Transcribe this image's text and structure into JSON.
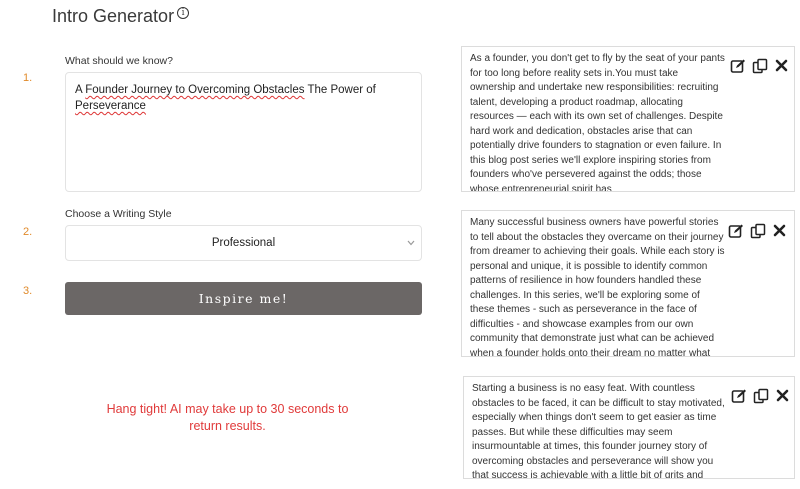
{
  "app": {
    "title": "Intro Generator",
    "info_glyph": "i"
  },
  "form": {
    "steps": [
      "1.",
      "2.",
      "3."
    ],
    "question_label": "What should we know?",
    "prompt_part1": "A ",
    "prompt_part2": "Founder Journey to Overcoming Obstacles",
    "prompt_part3": " The Power of ",
    "prompt_part4": "Perseverance",
    "style_label": "Choose a Writing Style",
    "style_value": "Professional",
    "submit_label": "Inspire me!",
    "wait_message": "Hang tight! AI may take up to 30 seconds to return results."
  },
  "results": [
    {
      "text": "As a founder, you don't get to fly by the seat of your pants for too long before reality sets in.You must take ownership and undertake new responsibilities: recruiting talent, developing a product roadmap, allocating resources — each with its own set of challenges. Despite hard work and dedication, obstacles arise that can potentially drive founders to stagnation or even failure. In this blog post series we'll explore inspiring stories from founders who've persevered against the odds; those whose entrepreneurial spirit has"
    },
    {
      "text": "Many successful business owners have powerful stories to tell about the obstacles they overcame on their journey from dreamer to achieving their goals. While each story is personal and unique, it is possible to identify common patterns of resilience in how founders handled these challenges. In this series, we'll be exploring some of these themes - such as perseverance in the face of difficulties - and showcase examples from our own community that demonstrate just what can be achieved when a founder holds onto their dream no matter what comes their"
    },
    {
      "text": "Starting a business is no easy feat. With countless obstacles to be faced, it can be difficult to stay motivated, especially when things don't seem to get easier as time passes. But while these difficulties may seem insurmountable at times, this founder journey story of overcoming obstacles and perseverance will show you that success is achievable with a little bit of grits and determination."
    }
  ],
  "icons": {
    "edit": "edit-icon",
    "copy": "copy-icon",
    "close": "close-icon",
    "info": "info-icon",
    "chevron": "chevron-down-icon"
  },
  "colors": {
    "step_number": "#e08a2a",
    "wait_text": "#e03a3a",
    "button_bg": "#6b6766"
  }
}
